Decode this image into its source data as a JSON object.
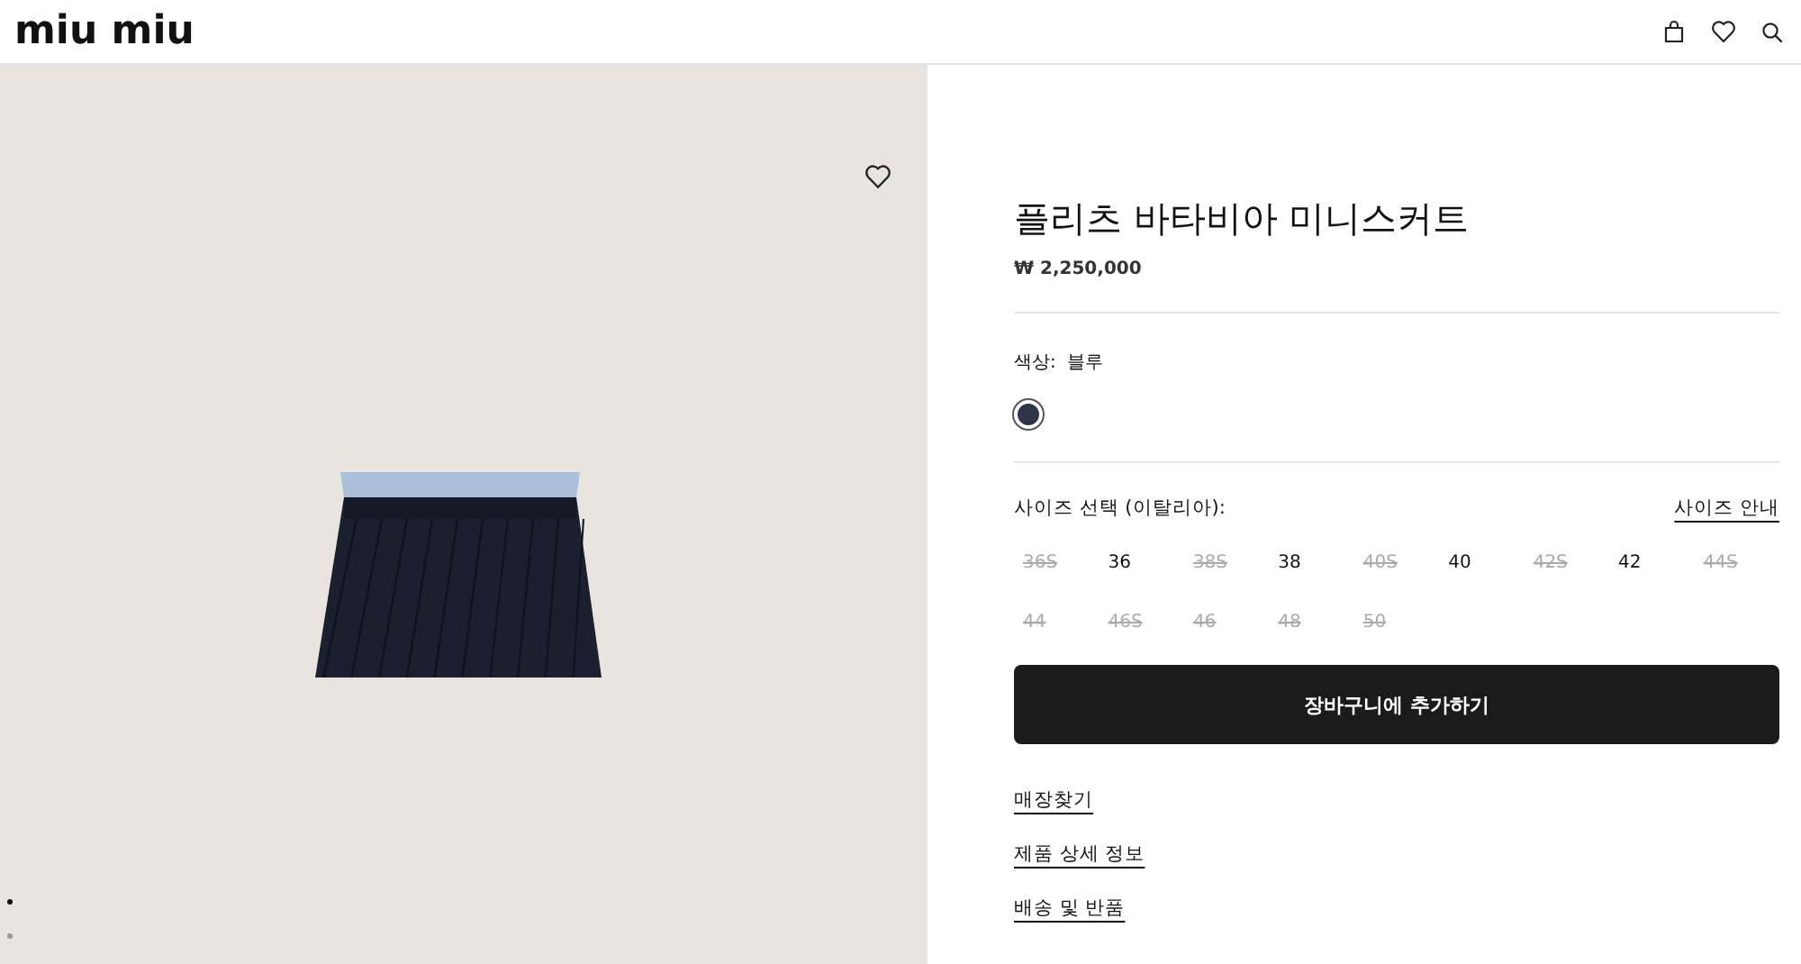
{
  "header": {
    "logo": "miu miu"
  },
  "gallery": {
    "slides": [
      {
        "selected": true
      },
      {
        "selected": false
      }
    ]
  },
  "product": {
    "title": "플리츠 바타비아 미니스커트",
    "price": "₩ 2,250,000",
    "color": {
      "label": "색상:",
      "value": "블루",
      "swatches": [
        {
          "color": "#2d3548",
          "selected": true
        }
      ]
    },
    "size": {
      "label": "사이즈 선택 (이탈리아):",
      "guide": "사이즈 안내",
      "options": [
        {
          "label": "36S",
          "available": false
        },
        {
          "label": "36",
          "available": true
        },
        {
          "label": "38S",
          "available": false
        },
        {
          "label": "38",
          "available": true
        },
        {
          "label": "40S",
          "available": false
        },
        {
          "label": "40",
          "available": true
        },
        {
          "label": "42S",
          "available": false
        },
        {
          "label": "42",
          "available": true
        },
        {
          "label": "44S",
          "available": false
        },
        {
          "label": "44",
          "available": false
        },
        {
          "label": "46S",
          "available": false
        },
        {
          "label": "46",
          "available": false
        },
        {
          "label": "48",
          "available": false
        },
        {
          "label": "50",
          "available": false
        }
      ]
    },
    "add_to_cart": "장바구니에 추가하기",
    "links": [
      "매장찾기",
      "제품 상세 정보",
      "배송 및 반품"
    ]
  }
}
